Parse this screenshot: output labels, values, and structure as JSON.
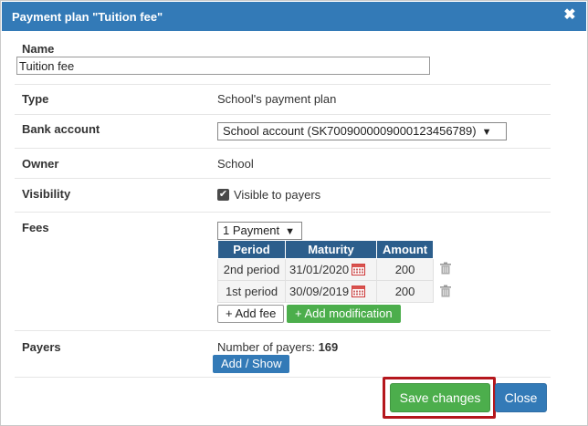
{
  "dialog": {
    "title": "Payment plan \"Tuition fee\"",
    "close_glyph": "✖"
  },
  "form": {
    "name_label": "Name",
    "name_value": "Tuition fee",
    "type_label": "Type",
    "type_value": "School's payment plan",
    "bank_label": "Bank account",
    "bank_value": "School account (SK7009000009000123456789)",
    "owner_label": "Owner",
    "owner_value": "School",
    "visibility_label": "Visibility",
    "visibility_checkbox_label": "Visible to payers",
    "visibility_checked": true,
    "fees_label": "Fees",
    "fees_select_value": "1 Payment",
    "fees_table": {
      "headers": [
        "Period",
        "Maturity",
        "Amount"
      ],
      "rows": [
        {
          "period": "2nd period",
          "maturity": "31/01/2020",
          "amount": "200"
        },
        {
          "period": "1st period",
          "maturity": "30/09/2019",
          "amount": "200"
        }
      ]
    },
    "add_fee_label": "+ Add fee",
    "add_modification_label": "+ Add modification",
    "payers_label": "Payers",
    "payers_count_prefix": "Number of payers:",
    "payers_count": "169",
    "add_show_label": "Add / Show"
  },
  "footer": {
    "save_label": "Save changes",
    "close_label": "Close"
  },
  "colors": {
    "header": "#337ab7",
    "table_header": "#2c5e8c",
    "success": "#4cae4c",
    "highlight": "#b5171d"
  },
  "icons": {
    "close": "close-icon",
    "calendar": "calendar-icon",
    "trash": "trash-icon",
    "dropdown": "caret-down-icon",
    "check": "checkmark-icon"
  }
}
